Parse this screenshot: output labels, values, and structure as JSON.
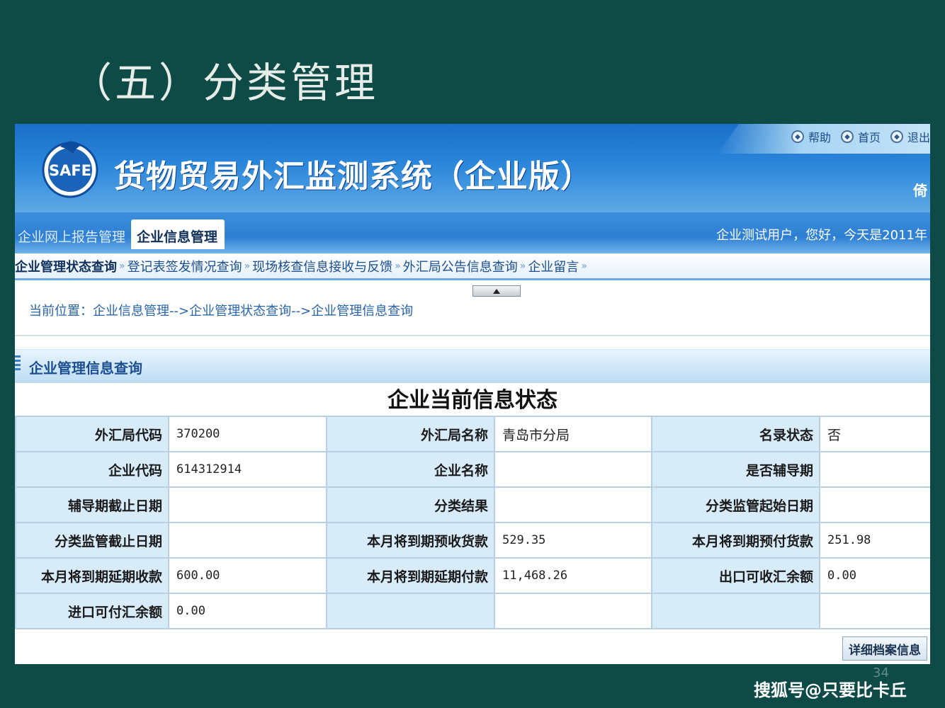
{
  "slide": {
    "title": "（五）分类管理",
    "page_number": "34",
    "watermark": "搜狐号@只要比卡丘"
  },
  "app": {
    "logo_text": "SAFE",
    "system_title": "货物贸易外汇监测系统（企业版）",
    "header_edge_text": "倚",
    "top_links": [
      {
        "label": "帮助",
        "icon": "help-icon"
      },
      {
        "label": "首页",
        "icon": "home-icon"
      },
      {
        "label": "退出",
        "icon": "logout-icon"
      }
    ],
    "module_tabs": [
      {
        "label": "企业网上报告管理",
        "active": false
      },
      {
        "label": "企业信息管理",
        "active": true
      }
    ],
    "greeting": "企业测试用户，您好，今天是2011年",
    "sub_nav": [
      "企业管理状态查询",
      "登记表签发情况查询",
      "现场核查信息接收与反馈",
      "外汇局公告信息查询",
      "企业留言"
    ],
    "breadcrumb": "当前位置：企业信息管理-->企业管理状态查询-->企业管理信息查询",
    "section_title": "企业管理信息查询",
    "table_title": "企业当前信息状态",
    "colors": {
      "header_blue": "#1a6fc8",
      "label_cell": "#d8ebf9",
      "slide_bg": "#0e4a46"
    }
  },
  "table": {
    "rows": [
      [
        {
          "label": "外汇局代码",
          "value": "370200"
        },
        {
          "label": "外汇局名称",
          "value": "青岛市分局"
        },
        {
          "label": "名录状态",
          "value": "否"
        }
      ],
      [
        {
          "label": "企业代码",
          "value": "614312914"
        },
        {
          "label": "企业名称",
          "value": ""
        },
        {
          "label": "是否辅导期",
          "value": ""
        }
      ],
      [
        {
          "label": "辅导期截止日期",
          "value": ""
        },
        {
          "label": "分类结果",
          "value": ""
        },
        {
          "label": "分类监管起始日期",
          "value": ""
        }
      ],
      [
        {
          "label": "分类监管截止日期",
          "value": ""
        },
        {
          "label": "本月将到期预收货款",
          "value": "529.35"
        },
        {
          "label": "本月将到期预付货款",
          "value": "251.98"
        }
      ],
      [
        {
          "label": "本月将到期延期收款",
          "value": "600.00"
        },
        {
          "label": "本月将到期延期付款",
          "value": "11,468.26"
        },
        {
          "label": "出口可收汇余额",
          "value": "0.00"
        }
      ],
      [
        {
          "label": "进口可付汇余额",
          "value": "0.00"
        },
        {
          "label": "",
          "value": ""
        },
        {
          "label": "",
          "value": ""
        }
      ]
    ]
  },
  "detail_button": "详细档案信息"
}
